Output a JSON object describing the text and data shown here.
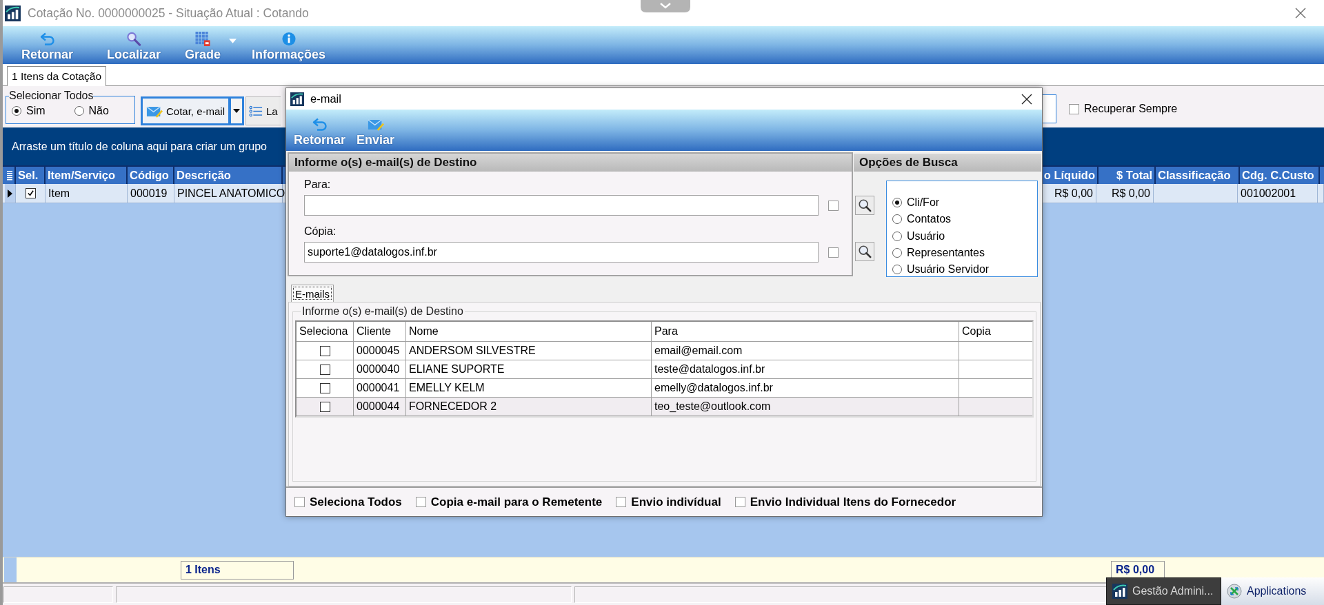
{
  "window": {
    "title": "Cotação No. 0000000025 - Situação Atual : Cotando"
  },
  "toolbar": [
    {
      "label": "Retornar",
      "kind": "return",
      "dropdown": false
    },
    {
      "label": "Localizar",
      "kind": "find",
      "dropdown": false
    },
    {
      "label": "Grade",
      "kind": "grid",
      "dropdown": true
    },
    {
      "label": "Informações",
      "kind": "info",
      "dropdown": false
    }
  ],
  "tabs": [
    {
      "label": "1 Itens da Cotação",
      "selected": true
    }
  ],
  "select_all": {
    "title": "Selecionar Todos",
    "options": [
      {
        "label": "Sim",
        "selected": true
      },
      {
        "label": "Não",
        "selected": false
      }
    ]
  },
  "actions": [
    {
      "label": "Cotar, e-mail",
      "kind": "email",
      "dropdown": true,
      "focused": true
    },
    {
      "label": "La",
      "kind": "list",
      "dropdown": false,
      "focused": false
    }
  ],
  "recover_always": {
    "label": "Recuperar Sempre",
    "checked": false
  },
  "group_panel": {
    "hint": "Arraste um título de coluna aqui para criar um grupo"
  },
  "grid": {
    "columns_left": [
      "Sel.",
      "Item/Serviço",
      "Código",
      "Descrição"
    ],
    "columns_right": [
      "o Líquido",
      "$ Total",
      "Classificação",
      "Cdg. C.Custo"
    ],
    "rows": [
      {
        "current": true,
        "checked": true,
        "item_type": "Item",
        "code": "000019",
        "description": "PINCEL ANATOMICO",
        "net_price": "R$ 0,00",
        "total": "R$ 0,00",
        "cost_center": "001002001"
      }
    ]
  },
  "footer": {
    "item_count": "1 Itens",
    "total": "R$ 0,00"
  },
  "taskbar": [
    {
      "label": "Gestão Admini...",
      "kind": "app",
      "selected": true
    },
    {
      "label": "Applications",
      "kind": "remote",
      "selected": false
    }
  ],
  "dialog": {
    "title": "e-mail",
    "toolbar": [
      {
        "label": "Retornar",
        "kind": "return"
      },
      {
        "label": "Enviar",
        "kind": "send"
      }
    ],
    "destination": {
      "heading": "Informe o(s) e-mail(s) de Destino",
      "fields": [
        {
          "label": "Para:",
          "checked": false
        },
        {
          "label": "Cópia:",
          "value": "suporte1@datalogos.inf.br",
          "checked": false
        }
      ]
    },
    "search_options": {
      "heading": "Opções de Busca",
      "options": [
        {
          "label": "Cli/For",
          "selected": true
        },
        {
          "label": "Contatos",
          "selected": false
        },
        {
          "label": "Usuário",
          "selected": false
        },
        {
          "label": "Representantes",
          "selected": false
        },
        {
          "label": "Usuário Servidor",
          "selected": false
        }
      ]
    },
    "tabs": [
      {
        "label": "E-mails",
        "selected": true
      }
    ],
    "recipients": {
      "legend": "Informe o(s) e-mail(s) de Destino",
      "columns": [
        "Seleciona",
        "Cliente",
        "Nome",
        "Para",
        "Copia"
      ],
      "rows": [
        {
          "checked": false,
          "client": "0000045",
          "name": "ANDERSOM SILVESTRE",
          "to": "email@email.com",
          "selected": false
        },
        {
          "checked": false,
          "client": "0000040",
          "name": "ELIANE SUPORTE",
          "to": "teste@datalogos.inf.br",
          "selected": false
        },
        {
          "checked": false,
          "client": "0000041",
          "name": "EMELLY KELM",
          "to": "emelly@datalogos.inf.br",
          "selected": false
        },
        {
          "checked": false,
          "client": "0000044",
          "name": "FORNECEDOR 2",
          "to": "teo_teste@outlook.com",
          "selected": true
        }
      ]
    },
    "options": [
      {
        "label": "Seleciona Todos",
        "checked": false
      },
      {
        "label": "Copia e-mail para o Remetente",
        "checked": false
      },
      {
        "label": "Envio indivídual",
        "checked": false
      },
      {
        "label": "Envio Individual Itens do Fornecedor",
        "checked": false
      }
    ]
  }
}
